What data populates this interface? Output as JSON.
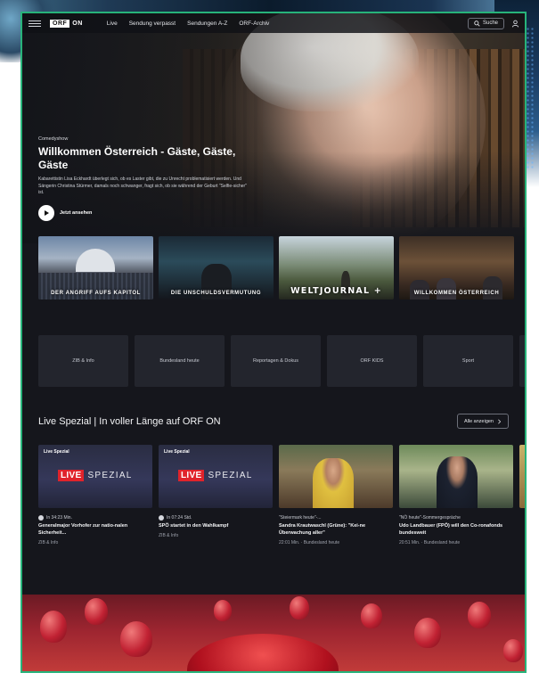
{
  "nav": {
    "logo_brand": "ORF",
    "logo_suffix": "ON",
    "links": [
      "Live",
      "Sendung verpasst",
      "Sendungen A-Z",
      "ORF-Archiv"
    ],
    "search_label": "Suche"
  },
  "hero": {
    "kicker": "Comedyshow",
    "title": "Willkommen Österreich - Gäste, Gäste, Gäste",
    "description": "Kabarettistin Lisa Eckhardt überlegt sich, ob es Laster gibt, die zu Unrecht problematisiert werden. Und Sängerin Christina Stürmer, damals noch schwanger, fragt sich, ob sie während der Geburt \"Selfie-sicher\" ist.",
    "watch_label": "Jetzt ansehen"
  },
  "teasers": [
    {
      "caption": "DER ANGRIFF AUFS KAPITOL"
    },
    {
      "caption": "DIE UNSCHULDSVERMUTUNG"
    },
    {
      "caption": "WELTJOURNAL +"
    },
    {
      "caption": "WILLKOMMEN ÖSTERREICH"
    }
  ],
  "categories": [
    "ZIB & Info",
    "Bundesland heute",
    "Reportagen & Dokus",
    "ORF KIDS",
    "Sport"
  ],
  "live_rail": {
    "title": "Live Spezial | In voller Länge auf ORF ON",
    "show_all_label": "Alle anzeigen",
    "live_box": "LIVE",
    "live_word": "SPEZIAL",
    "cards": [
      {
        "tag": "Live Spezial",
        "meta": "In 34:23 Min.",
        "title": "Generalmajor Vorhofer zur natio-nalen Sicherheit...",
        "sub": "ZIB & Info"
      },
      {
        "tag": "Live Spezial",
        "meta": "In 07:24 Std.",
        "title": "SPÖ startet in den Wahlkampf",
        "sub": "ZIB & Info"
      },
      {
        "tag": "",
        "meta": "\"Steiermark heute\"-...",
        "title": "Sandra Krautwaschl (Grüne): \"Kei-ne Überwachung aller\"",
        "sub": "22:01 Min. · Bundesland heute"
      },
      {
        "tag": "",
        "meta": "\"NÖ heute\"-Sommergespräche",
        "title": "Udo Landbauer (FPÖ) will den Co-ronafonds bundesweit",
        "sub": "20:51 Min. · Bundesland heute"
      }
    ]
  }
}
